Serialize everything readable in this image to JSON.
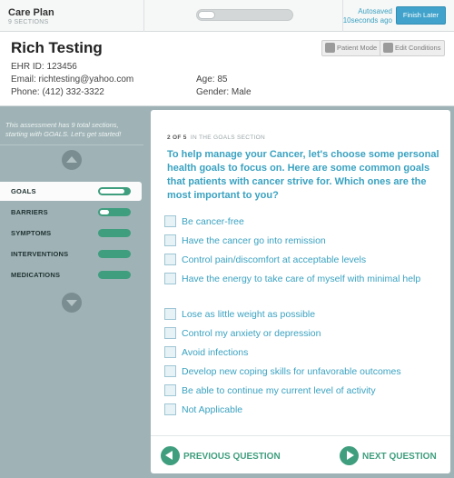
{
  "topbar": {
    "title": "Care Plan",
    "subtitle": "9 SECTIONS",
    "progress_fraction": 0.18,
    "autosave_label": "Autosaved",
    "autosave_time": "10seconds ago",
    "finish_label": "Finish Later"
  },
  "patient": {
    "name": "Rich Testing",
    "ehr_id": "EHR ID: 123456",
    "email": "Email: richtesting@yahoo.com",
    "phone": "Phone: (412) 332-3322",
    "age": "Age: 85",
    "gender": "Gender: Male",
    "patient_mode_label": "Patient Mode",
    "edit_conditions_label": "Edit Conditions"
  },
  "sidebar": {
    "intro": "This assessment has 9 total sections, starting with GOALS. Let's get started!",
    "items": [
      {
        "label": "GOALS",
        "active": true,
        "progress": 0.85
      },
      {
        "label": "BARRIERS",
        "active": false,
        "progress": 0.3
      },
      {
        "label": "SYMPTOMS",
        "active": false,
        "progress": 0
      },
      {
        "label": "INTERVENTIONS",
        "active": false,
        "progress": 0
      },
      {
        "label": "MEDICATIONS",
        "active": false,
        "progress": 0
      }
    ]
  },
  "main": {
    "step": "2 OF 5",
    "step_section": "IN THE GOALS SECTION",
    "question": "To help manage your Cancer, let's choose some personal health goals to focus on. Here are some common goals that patients with cancer strive for. Which ones are the most important to you?",
    "options": [
      "Be cancer-free",
      "Have the cancer go into remission",
      "Control pain/discomfort at acceptable levels",
      "Have the energy to take care of myself with minimal help",
      "Lose as little weight as possible",
      "Control my anxiety or depression",
      "Avoid infections",
      "Develop new coping skills for unfavorable outcomes",
      "Be able to continue my current level of activity",
      "Not Applicable"
    ],
    "prev_label": "PREVIOUS QUESTION",
    "next_label": "NEXT QUESTION"
  },
  "colors": {
    "accent_blue": "#3aa2c1",
    "accent_green": "#3f9e7e",
    "background": "#9fb3b6"
  }
}
